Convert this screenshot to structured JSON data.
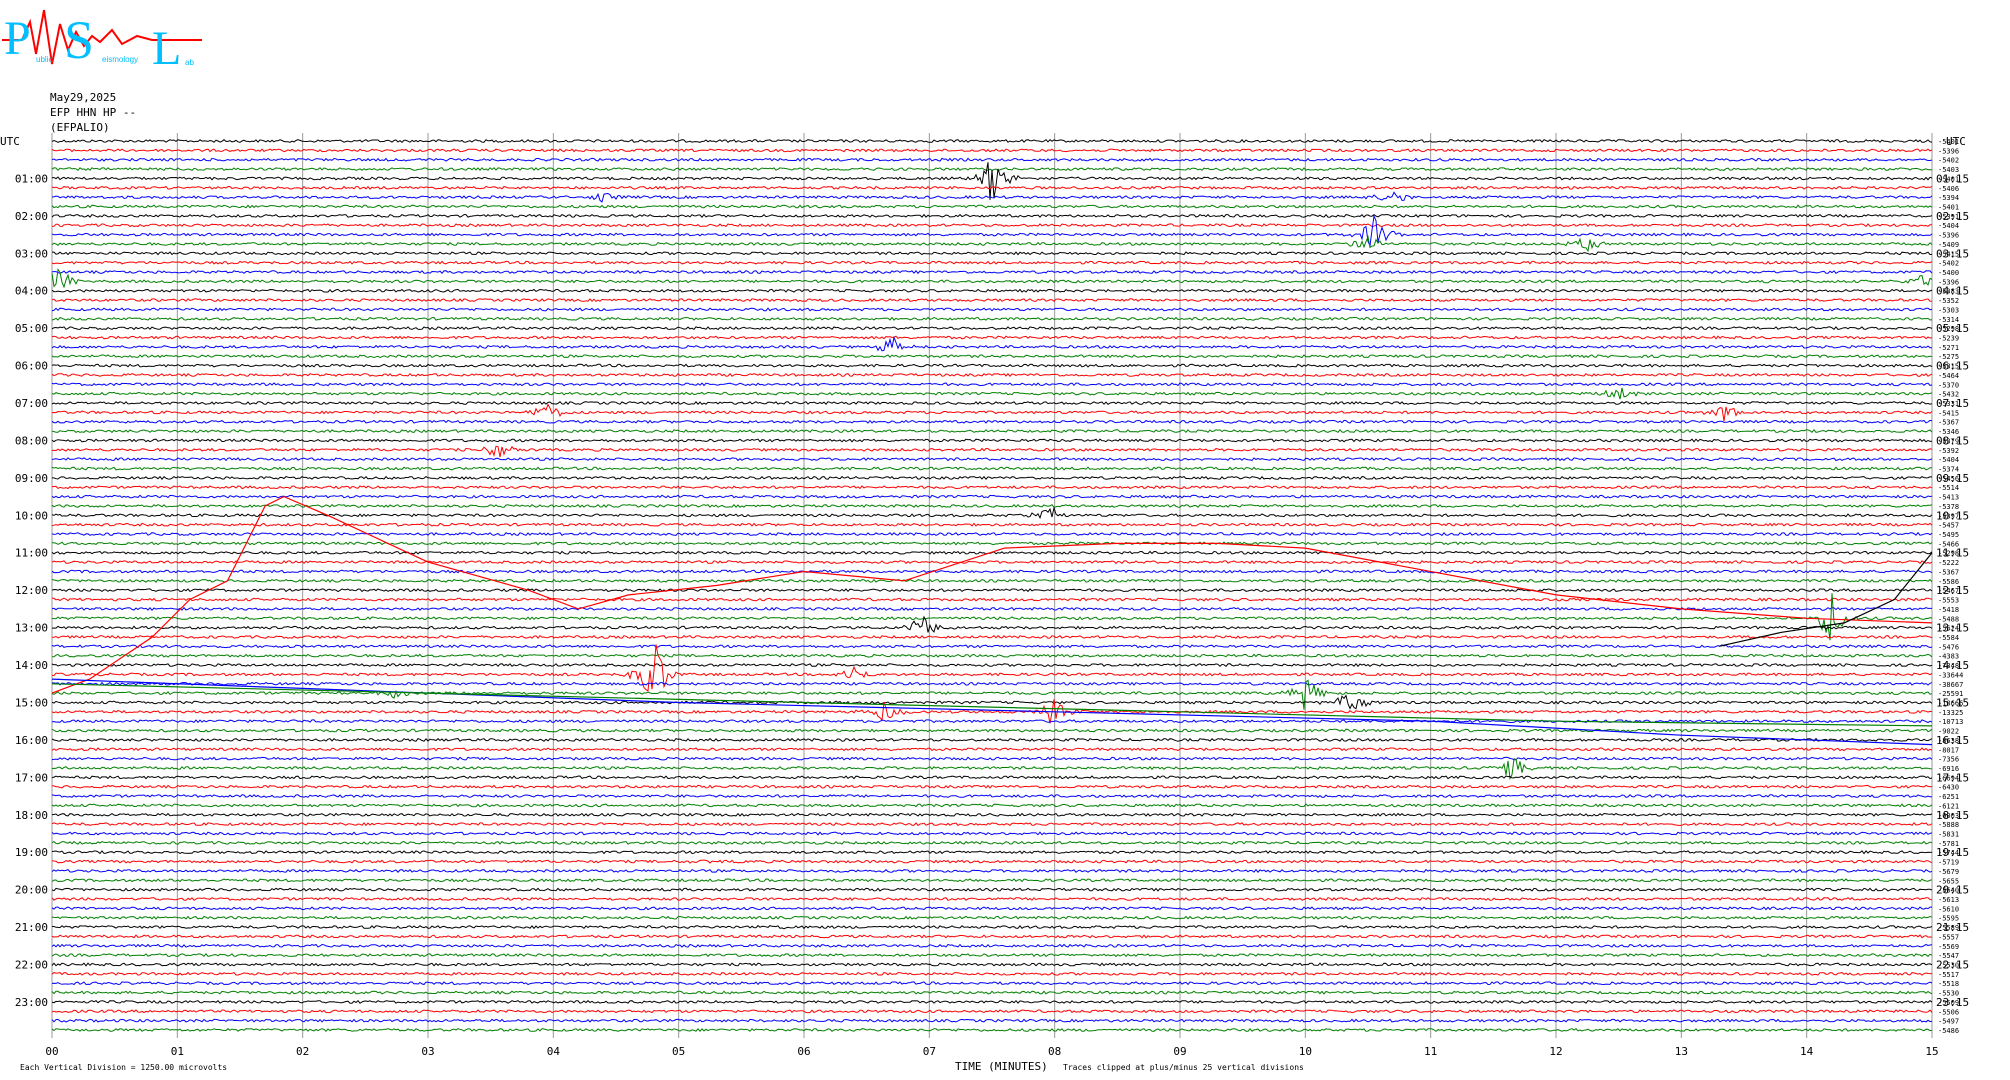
{
  "logo": {
    "letters": [
      "P",
      "S",
      "L"
    ],
    "subtext": [
      "ublic",
      "eismology",
      "ab"
    ],
    "colors": {
      "letters": "#00bfff",
      "trace": "#ff0000"
    }
  },
  "header": {
    "date": "May29,2025",
    "station": "EFP HHN HP --",
    "site": "(EFPALIO)"
  },
  "left_axis_title": "UTC",
  "right_axis_title": "UTC",
  "footer": {
    "left_note": "Each Vertical Division = 1250.00 microvolts",
    "xlabel": "TIME (MINUTES)",
    "clip_note": "Traces clipped at plus/minus 25 vertical divisions"
  },
  "chart_data": {
    "type": "line",
    "description_type": "helicorder",
    "xlim": [
      0,
      15
    ],
    "x_ticks": [
      "00",
      "01",
      "02",
      "03",
      "04",
      "05",
      "06",
      "07",
      "08",
      "09",
      "10",
      "11",
      "12",
      "13",
      "14",
      "15"
    ],
    "rows": 96,
    "row_minutes": 15,
    "trace_colors": [
      "#000000",
      "#ff0000",
      "#0000ff",
      "#008000"
    ],
    "grid": true,
    "left_hour_labels": [
      "01:00",
      "02:00",
      "03:00",
      "04:00",
      "05:00",
      "06:00",
      "07:00",
      "08:00",
      "09:00",
      "10:00",
      "11:00",
      "12:00",
      "13:00",
      "14:00",
      "15:00",
      "16:00",
      "17:00",
      "18:00",
      "19:00",
      "20:00",
      "21:00",
      "22:00",
      "23:00"
    ],
    "right_hour_labels": [
      "01:15",
      "02:15",
      "03:15",
      "04:15",
      "05:15",
      "06:15",
      "07:15",
      "08:15",
      "09:15",
      "10:15",
      "11:15",
      "12:15",
      "13:15",
      "14:15",
      "15:15",
      "16:15",
      "17:15",
      "18:15",
      "19:15",
      "20:15",
      "21:15",
      "22:15",
      "23:15"
    ],
    "row_offsets": [
      "-5401",
      "-5396",
      "-5402",
      "-5403",
      "-5401",
      "-5406",
      "-5394",
      "-5401",
      "-5391",
      "-5404",
      "-5396",
      "-5409",
      "-5415",
      "-5402",
      "-5400",
      "-5396",
      "-5383",
      "-5352",
      "-5303",
      "-5314",
      "-5298",
      "-5239",
      "-5271",
      "-5275",
      "-5315",
      "-5464",
      "-5370",
      "-5432",
      "-5331",
      "-5415",
      "-5367",
      "-5346",
      "-5379",
      "-5392",
      "-5404",
      "-5374",
      "-5456",
      "-5514",
      "-5413",
      "-5378",
      "-5397",
      "-5457",
      "-5495",
      "-5466",
      "-5298",
      "-5222",
      "-5367",
      "-5586",
      "-5467",
      "-5553",
      "-5418",
      "-5488",
      "-5624",
      "-5584",
      "-5476",
      "-4383",
      "-7348",
      "-33644",
      "-38667",
      "-25591",
      "-18666",
      "-13325",
      "-10713",
      "-9022",
      "-8638",
      "-8017",
      "-7356",
      "-6916",
      "-6694",
      "-6430",
      "-6251",
      "-6121",
      "-6003",
      "-5888",
      "-5831",
      "-5781",
      "-5744",
      "-5719",
      "-5679",
      "-5655",
      "-5640",
      "-5613",
      "-5610",
      "-5595",
      "-5589",
      "-5557",
      "-5569",
      "-5547",
      "-5530",
      "-5517",
      "-5518",
      "-5530",
      "-5509",
      "-5506",
      "-5497",
      "-5486",
      "-5502"
    ],
    "events": [
      {
        "row": 4,
        "minute": 7.5,
        "amp": 28
      },
      {
        "row": 6,
        "minute": 4.4,
        "amp": 5
      },
      {
        "row": 6,
        "minute": 10.7,
        "amp": 10
      },
      {
        "row": 10,
        "minute": 10.55,
        "amp": 20
      },
      {
        "row": 11,
        "minute": 12.25,
        "amp": 9
      },
      {
        "row": 11,
        "minute": 10.5,
        "amp": 12
      },
      {
        "row": 15,
        "minute": 0.05,
        "amp": 18
      },
      {
        "row": 15,
        "minute": 14.95,
        "amp": 14
      },
      {
        "row": 22,
        "minute": 6.7,
        "amp": 14
      },
      {
        "row": 27,
        "minute": 12.5,
        "amp": 8
      },
      {
        "row": 29,
        "minute": 3.95,
        "amp": 12
      },
      {
        "row": 29,
        "minute": 13.35,
        "amp": 12
      },
      {
        "row": 33,
        "minute": 3.55,
        "amp": 12
      },
      {
        "row": 40,
        "minute": 7.95,
        "amp": 12
      },
      {
        "row": 52,
        "minute": 6.95,
        "amp": 16
      },
      {
        "row": 51,
        "minute": 14.2,
        "amp": 30
      },
      {
        "row": 57,
        "minute": 4.8,
        "amp": 45
      },
      {
        "row": 57,
        "minute": 6.4,
        "amp": 10
      },
      {
        "row": 59,
        "minute": 2.75,
        "amp": 6
      },
      {
        "row": 61,
        "minute": 6.65,
        "amp": 12
      },
      {
        "row": 61,
        "minute": 8.0,
        "amp": 18
      },
      {
        "row": 59,
        "minute": 10.0,
        "amp": 20
      },
      {
        "row": 60,
        "minute": 10.35,
        "amp": 16
      },
      {
        "row": 67,
        "minute": 11.65,
        "amp": 14
      },
      {
        "row": 77,
        "minute": 5.2,
        "amp": 3
      },
      {
        "row": 84,
        "minute": 5.8,
        "amp": 3
      }
    ]
  }
}
